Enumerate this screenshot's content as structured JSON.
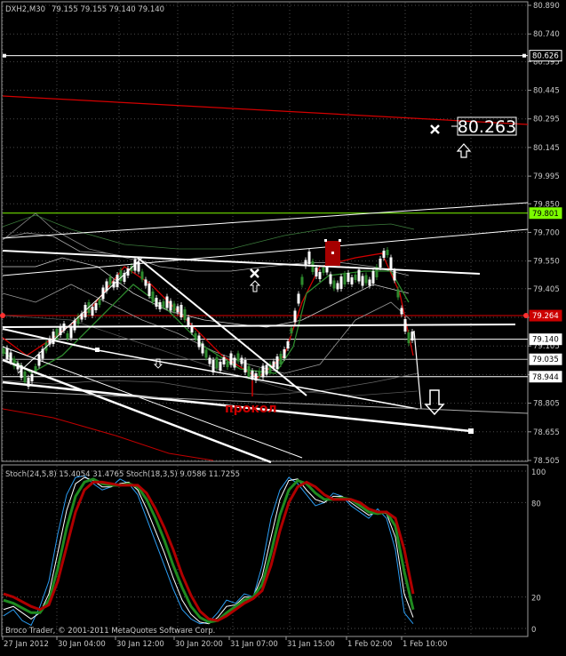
{
  "colors": {
    "bg": "#000000",
    "text": "#c8c8c8",
    "frame": "#9a9a9a",
    "grid": "#4a4a4a",
    "price_line": "#ffffff",
    "red": "#d40000",
    "green": "#2e8b2e",
    "lime": "#7cfc00",
    "white_label_bg": "#ffffff",
    "label_red": "#cc0000"
  },
  "header": {
    "symbol_tf": "DXH2,M30",
    "ohlc": "79.155 79.155 79.140 79.140"
  },
  "price_axis": {
    "ticks": [
      "80.890",
      "80.740",
      "80.595",
      "80.445",
      "80.295",
      "80.145",
      "79.995",
      "79.850",
      "79.700",
      "79.550",
      "79.405",
      "79.255",
      "79.105",
      "78.955",
      "78.805",
      "78.655",
      "78.505"
    ],
    "labels": [
      {
        "text": "80.626",
        "price": 80.626,
        "style": "white"
      },
      {
        "text": "79.801",
        "price": 79.801,
        "style": "lime"
      },
      {
        "text": "79.264",
        "price": 79.264,
        "style": "red"
      },
      {
        "text": "79.140",
        "price": 79.14,
        "style": "white"
      },
      {
        "text": "79.035",
        "price": 79.035,
        "style": "white"
      },
      {
        "text": "78.944",
        "price": 78.944,
        "style": "white"
      }
    ]
  },
  "annotations": {
    "target_price": "80.263",
    "puncture_label": "прокол"
  },
  "stochastic": {
    "header": "Stoch(24,5,8) 15.4054 31.4765   Stoch(18,3,5) 9.0586 11.7255",
    "levels": [
      "100",
      "80",
      "20",
      "0"
    ]
  },
  "time_axis": [
    "27 Jan 2012",
    "30 Jan 04:00",
    "30 Jan 12:00",
    "30 Jan 20:00",
    "31 Jan 07:00",
    "31 Jan 15:00",
    "1 Feb 02:00",
    "1 Feb 10:00"
  ],
  "footer": "Broco Trader, © 2001-2011 MetaQuotes Software Corp."
}
